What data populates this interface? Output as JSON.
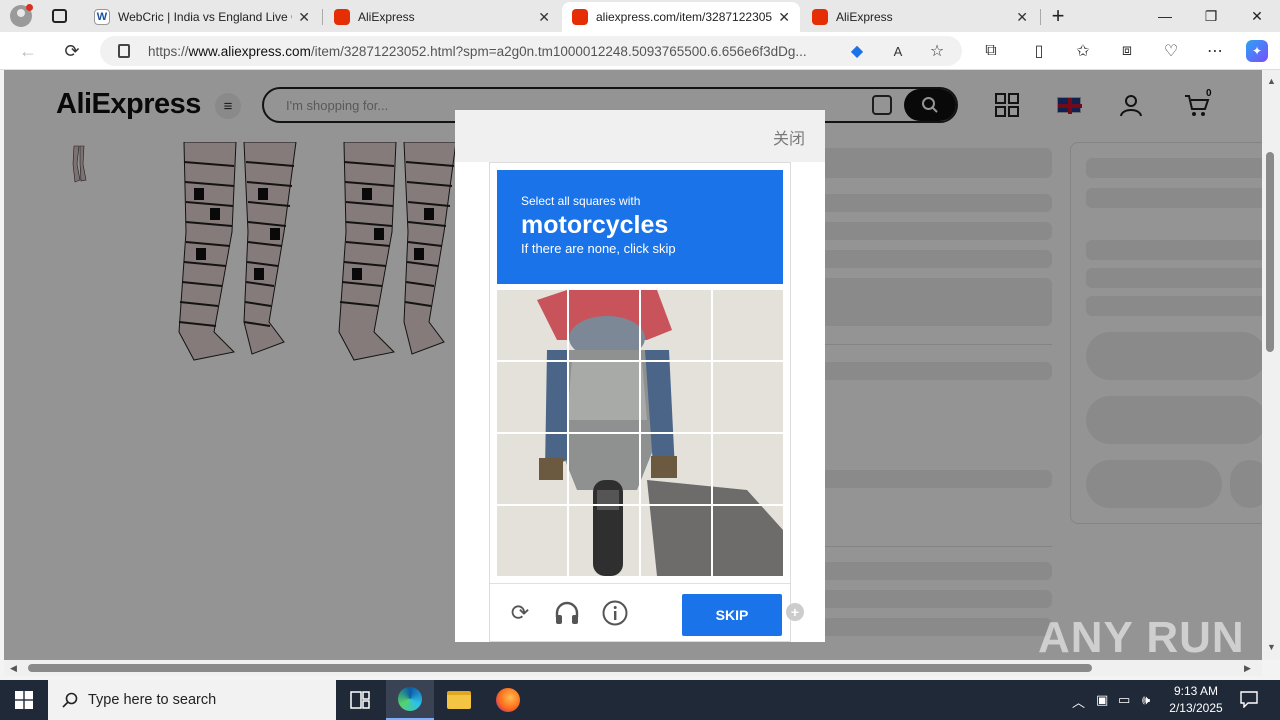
{
  "browser": {
    "tabs": [
      {
        "title": "WebCric | India vs England Live C",
        "active": false,
        "favicon": "webcric-icon"
      },
      {
        "title": "AliExpress",
        "active": false,
        "favicon": "aliexpress-icon"
      },
      {
        "title": "aliexpress.com/item/3287122305",
        "active": true,
        "favicon": "aliexpress-icon"
      },
      {
        "title": "AliExpress",
        "active": false,
        "favicon": "aliexpress-icon"
      }
    ],
    "url_prefix": "https://",
    "url_host": "www.aliexpress.com",
    "url_rest": "/item/32871223052.html?spm=a2g0n.tm1000012248.5093765500.6.656e6f3dDg..."
  },
  "site": {
    "logo": "AliExpress",
    "search_placeholder": "I'm shopping for...",
    "cart_count": "0"
  },
  "modal": {
    "close_label": "关闭",
    "captcha": {
      "instruction_line1": "Select all squares with",
      "target": "motorcycles",
      "instruction_line2": "If there are none, click skip",
      "skip_label": "SKIP",
      "grid_rows": 4,
      "grid_cols": 4
    }
  },
  "watermark": "ANY RUN",
  "taskbar": {
    "search_placeholder": "Type here to search",
    "time": "9:13 AM",
    "date": "2/13/2025"
  },
  "colors": {
    "captcha_blue": "#1a73e8",
    "aliexpress_red": "#e62e04",
    "taskbar": "#202938"
  }
}
